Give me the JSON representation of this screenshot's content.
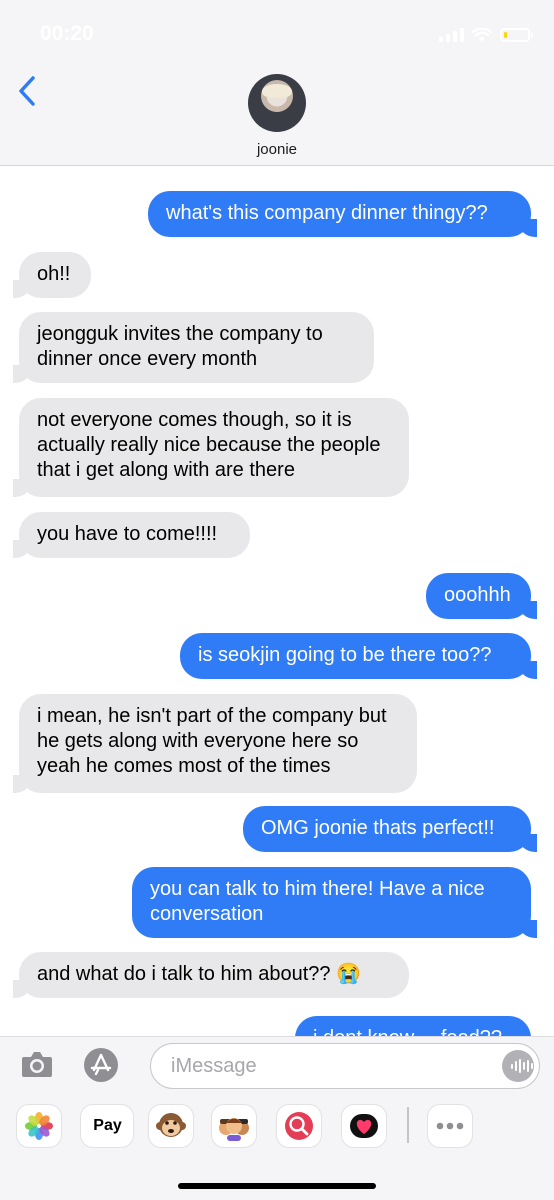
{
  "status_bar": {
    "time": "00:20"
  },
  "contact": {
    "name": "joonie"
  },
  "messages": [
    {
      "from": "me",
      "text": "what's this company dinner thingy??"
    },
    {
      "from": "them",
      "text": "oh!!"
    },
    {
      "from": "them",
      "text": "jeongguk invites the company to dinner once every month"
    },
    {
      "from": "them",
      "text": "not everyone comes though, so it is actually really nice because the people that i get along with are there"
    },
    {
      "from": "them",
      "text": "you have to come!!!!"
    },
    {
      "from": "me",
      "text": "ooohhh"
    },
    {
      "from": "me",
      "text": "is seokjin going to be there too??"
    },
    {
      "from": "them",
      "text": "i mean, he isn't part of the company but he gets along with everyone here so yeah he comes most of the times"
    },
    {
      "from": "me",
      "text": "OMG joonie thats perfect!!"
    },
    {
      "from": "me",
      "text": "you can talk to him there! Have a nice conversation"
    },
    {
      "from": "them",
      "text": "and what do i talk to him about?? 😭"
    },
    {
      "from": "me",
      "text": "i dont know.... food??"
    }
  ],
  "composer": {
    "placeholder": "iMessage",
    "value": ""
  },
  "app_drawer": {
    "pay_label": "Pay",
    "apple_glyph": "",
    "items": [
      "photos-icon",
      "apple-pay-icon",
      "monkey-icon",
      "memoji-icon",
      "web-search-icon",
      "digital-touch-icon",
      "more-icon"
    ]
  },
  "colors": {
    "outgoing_bubble": "#2f7cf6",
    "incoming_bubble": "#e8e8ea",
    "back_chevron": "#2f7cf6",
    "header_bg": "#f5f5f7"
  }
}
